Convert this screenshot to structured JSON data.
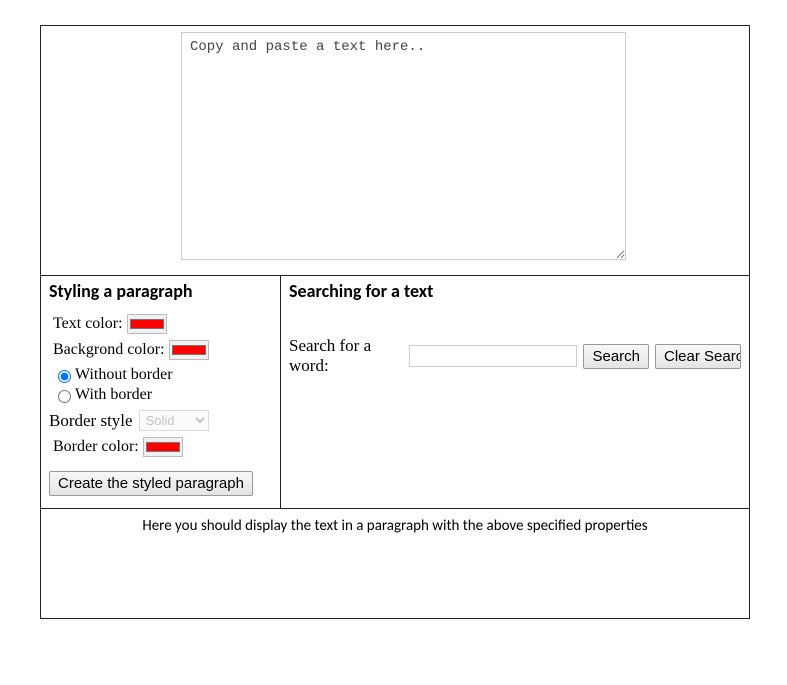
{
  "textarea": {
    "placeholder": "Copy and paste a text here.."
  },
  "styling": {
    "heading": "Styling a paragraph",
    "text_color_label": "Text color:",
    "text_color_value": "#ff0000",
    "background_color_label": "Backgrond color:",
    "background_color_value": "#ff0000",
    "radio_without_border": "Without border",
    "radio_with_border": "With border",
    "border_style_label": "Border style",
    "border_style_options": [
      "Solid"
    ],
    "border_style_selected": "Solid",
    "border_color_label": "Border color:",
    "border_color_value": "#ff0000",
    "create_button": "Create the styled paragraph"
  },
  "searching": {
    "heading": "Searching for a text",
    "search_label": "Search for a word:",
    "search_button": "Search",
    "clear_button": "Clear Search"
  },
  "bottom": {
    "message": "Here you should display the text in a paragraph with the above specified properties"
  }
}
